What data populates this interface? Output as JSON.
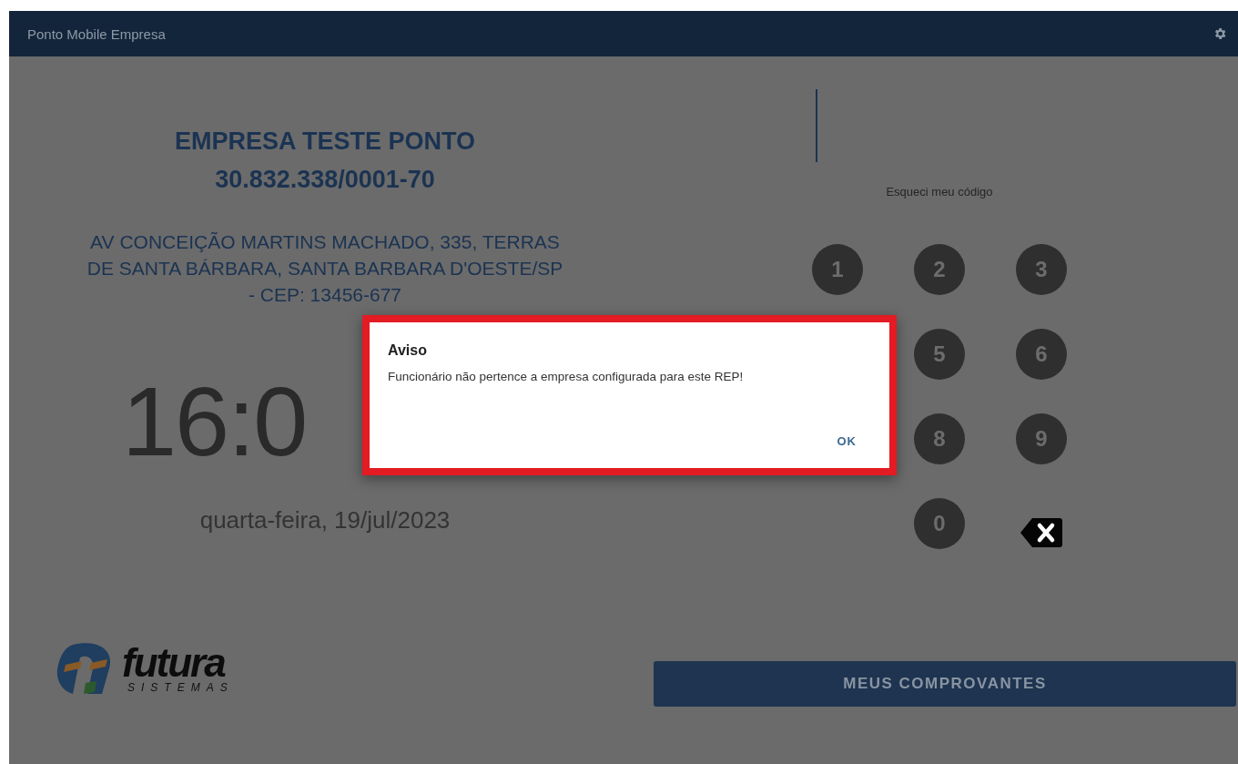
{
  "app_bar": {
    "title": "Ponto Mobile Empresa"
  },
  "company": {
    "name": "EMPRESA TESTE PONTO",
    "cnpj": "30.832.338/0001-70",
    "address_lines": [
      "AV CONCEIÇÃO MARTINS MACHADO, 335, TERRAS",
      "DE SANTA BÁRBARA, SANTA BARBARA D'OESTE/SP",
      "- CEP: 13456-677"
    ]
  },
  "clock": {
    "time": "16:0",
    "date": "quarta-feira, 19/jul/2023"
  },
  "logo": {
    "name": "futura",
    "tagline": "SISTEMAS"
  },
  "forgot_link": "Esqueci meu código",
  "keypad": [
    {
      "kind": "digit",
      "label": "1"
    },
    {
      "kind": "digit",
      "label": "2"
    },
    {
      "kind": "digit",
      "label": "3"
    },
    {
      "kind": "covered"
    },
    {
      "kind": "digit",
      "label": "5"
    },
    {
      "kind": "digit",
      "label": "6"
    },
    {
      "kind": "covered"
    },
    {
      "kind": "digit",
      "label": "8"
    },
    {
      "kind": "digit",
      "label": "9"
    },
    {
      "kind": "blank"
    },
    {
      "kind": "digit",
      "label": "0"
    },
    {
      "kind": "backspace"
    }
  ],
  "receipts_button": "MEUS COMPROVANTES",
  "dialog": {
    "title": "Aviso",
    "message": "Funcionário não pertence a empresa configurada para este REP!",
    "action": "OK"
  }
}
